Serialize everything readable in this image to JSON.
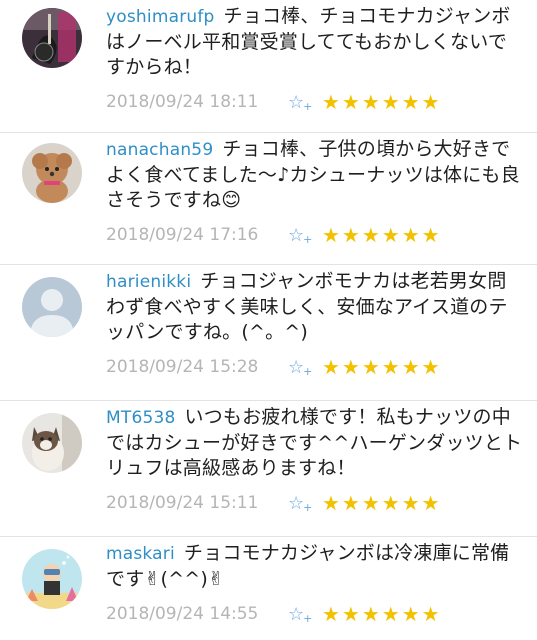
{
  "comments": [
    {
      "username": "yoshimarufp",
      "text": "チョコ棒、チョコモナカジャンボはノーベル平和賞受賞しててもおかしくないですからね！",
      "timestamp": "2018/09/24 18:11",
      "rating": "★★★★★★",
      "add_star": "☆",
      "add_plus": "+",
      "avatar": "guitar-photo"
    },
    {
      "username": "nanachan59",
      "text": "チョコ棒、子供の頃から大好きでよく食べてました〜♪カシューナッツは体にも良さそうですね😊",
      "timestamp": "2018/09/24 17:16",
      "rating": "★★★★★★",
      "add_star": "☆",
      "add_plus": "+",
      "avatar": "poodle-photo"
    },
    {
      "username": "harienikki",
      "text": "チョコジャンボモナカは老若男女問わず食べやすく美味しく、安価なアイス道のテッパンですね。(^。^)",
      "timestamp": "2018/09/24 15:28",
      "rating": "★★★★★★",
      "add_star": "☆",
      "add_plus": "+",
      "avatar": "default-user"
    },
    {
      "username": "MT6538",
      "text": "いつもお疲れ様です！私もナッツの中ではカシューが好きです^^ハーゲンダッツとトリュフは高級感ありますね！",
      "timestamp": "2018/09/24 15:11",
      "rating": "★★★★★★",
      "add_star": "☆",
      "add_plus": "+",
      "avatar": "cat-photo"
    },
    {
      "username": "maskari",
      "text": "チョコモナカジャンボは冷凍庫に常備です✌(^^)✌",
      "timestamp": "2018/09/24 14:55",
      "rating": "★★★★★★",
      "add_star": "☆",
      "add_plus": "+",
      "avatar": "diver-illustration"
    }
  ]
}
